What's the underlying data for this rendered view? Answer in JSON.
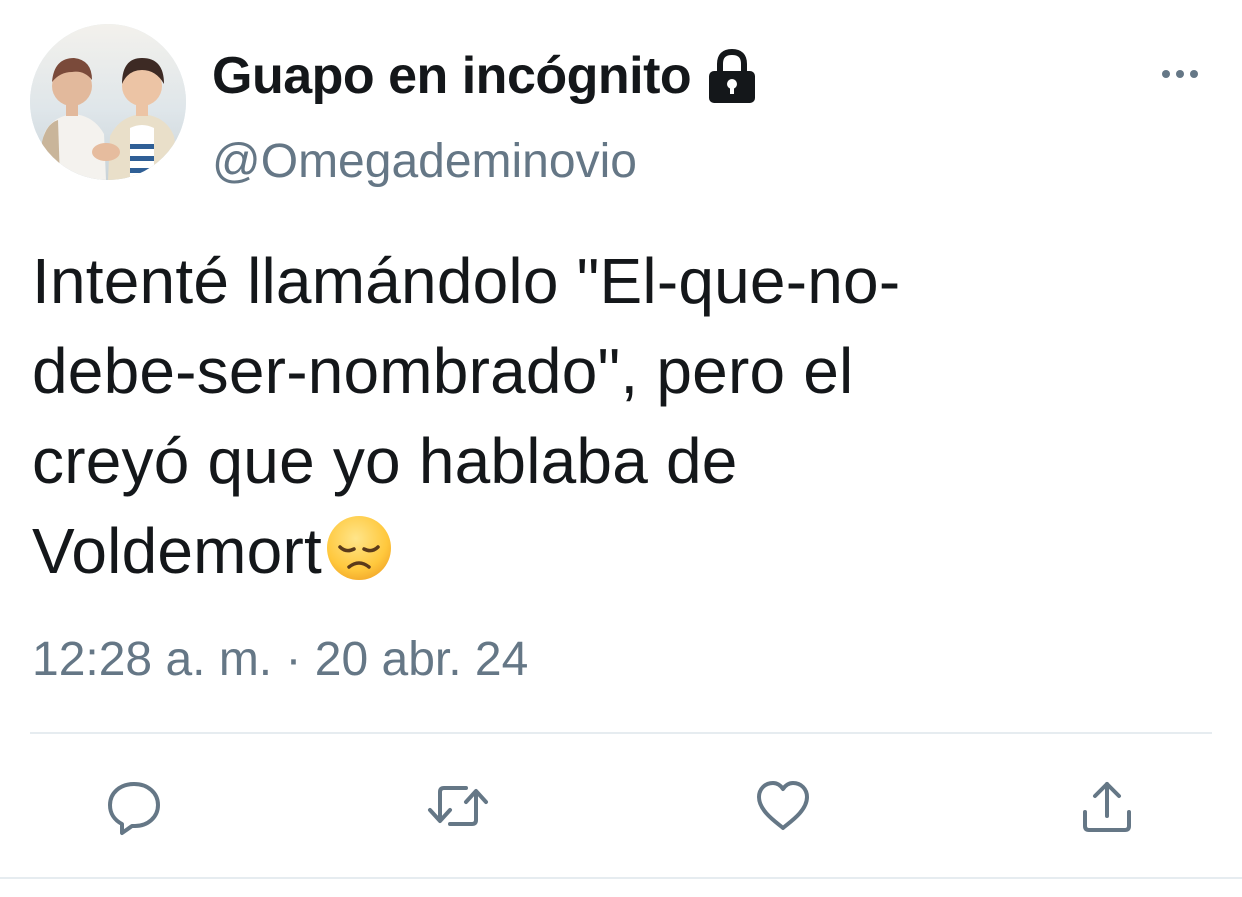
{
  "user": {
    "display_name": "Guapo en incógnito",
    "handle": "@Omegademinovio",
    "lock_icon": "lock-icon",
    "avatar_icon": "avatar"
  },
  "tweet": {
    "lines": [
      "Intenté llamándolo \"El-que-no-",
      "debe-ser-nombrado\", pero el",
      "creyó que yo hablaba de",
      "Voldemort"
    ],
    "emoji": "disappointed-face-emoji",
    "timestamp": "12:28 a. m. · 20 abr. 24"
  },
  "actions": {
    "reply": "reply-icon",
    "retweet": "retweet-icon",
    "like": "like-icon",
    "share": "share-icon",
    "more": "more-icon"
  },
  "colors": {
    "text": "#14171a",
    "secondary": "#657786",
    "divider": "#e6ecf0",
    "icon": "#657786"
  }
}
